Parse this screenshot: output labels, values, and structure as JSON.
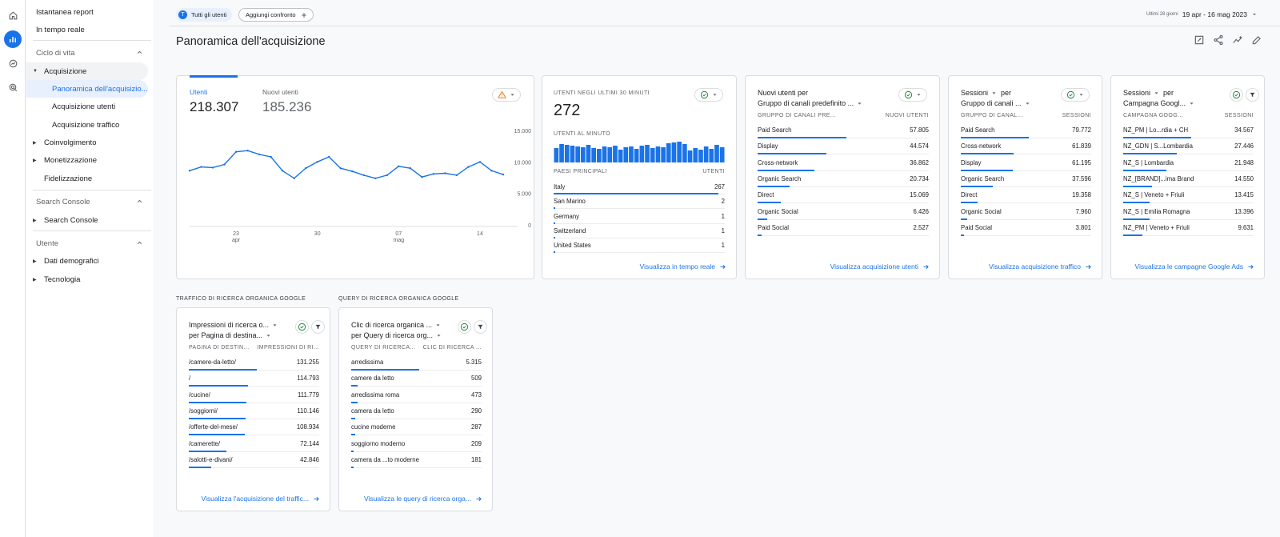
{
  "nav": {
    "top": [
      "Istantanea report",
      "In tempo reale"
    ],
    "section1": "Ciclo di vita",
    "acquisizione": "Acquisizione",
    "sub": [
      "Panoramica dell'acquisizio...",
      "Acquisizione utenti",
      "Acquisizione traffico"
    ],
    "coinvolgimento": "Coinvolgimento",
    "monetizzazione": "Monetizzazione",
    "fidelizzazione": "Fidelizzazione",
    "section2": "Search Console",
    "searchconsole": "Search Console",
    "section3": "Utente",
    "demografici": "Dati demografici",
    "tecnologia": "Tecnologia"
  },
  "topbar": {
    "chip_avatar": "T",
    "chip_label": "Tutti gli utenti",
    "compare_label": "Aggiungi confronto",
    "date_small": "Ultimi 28 giorni",
    "date_range": "19 apr - 16 mag 2023"
  },
  "page_title": "Panoramica dell'acquisizione",
  "overview": {
    "tab1_label": "Utenti",
    "tab1_value": "218.307",
    "tab2_label": "Nuovi utenti",
    "tab2_value": "185.236",
    "y_ticks": [
      "15.000",
      "10.000",
      "5.000",
      "0"
    ],
    "x_ticks": [
      {
        "day": "23",
        "month": "apr"
      },
      {
        "day": "30",
        "month": ""
      },
      {
        "day": "07",
        "month": "mag"
      },
      {
        "day": "14",
        "month": ""
      }
    ]
  },
  "chart_data": {
    "type": "line",
    "series": [
      {
        "values": [
          8600,
          9200,
          9100,
          9600,
          11600,
          11800,
          11200,
          10800,
          8600,
          7400,
          9000,
          10000,
          10800,
          9000,
          8500,
          7900,
          7400,
          7900,
          9300,
          9000,
          7600,
          8100,
          8200,
          7900,
          9200,
          10000,
          8600,
          8000
        ]
      }
    ],
    "ylim": [
      0,
      15000
    ],
    "x_tick_labels": [
      "23 apr",
      "30",
      "07 mag",
      "14"
    ],
    "grid": false
  },
  "realtime": {
    "caption": "UTENTI NEGLI ULTIMI 30 MINUTI",
    "value": "272",
    "per_min_caption": "UTENTI AL MINUTO",
    "per_min_values": [
      18,
      23,
      22,
      21,
      20,
      19,
      22,
      18,
      17,
      20,
      19,
      21,
      16,
      19,
      20,
      17,
      21,
      22,
      18,
      20,
      19,
      24,
      25,
      26,
      23,
      15,
      18,
      16,
      20,
      17,
      22,
      19
    ],
    "countries_header": "PAESI PRINCIPALI",
    "users_header": "UTENTI",
    "countries": [
      {
        "name": "Italy",
        "value": "267"
      },
      {
        "name": "San Marino",
        "value": "2"
      },
      {
        "name": "Germany",
        "value": "1"
      },
      {
        "name": "Switzerland",
        "value": "1"
      },
      {
        "name": "United States",
        "value": "1"
      }
    ],
    "link": "Visualizza in tempo reale"
  },
  "card_new_users": {
    "title1": "Nuovi utenti per",
    "title2": "Gruppo di canali predefinito ...",
    "col1": "GRUPPO DI CANALI PRE...",
    "col2": "NUOVI UTENTI",
    "rows": [
      {
        "label": "Paid Search",
        "value": "57.805"
      },
      {
        "label": "Display",
        "value": "44.574"
      },
      {
        "label": "Cross-network",
        "value": "36.862"
      },
      {
        "label": "Organic Search",
        "value": "20.734"
      },
      {
        "label": "Direct",
        "value": "15.069"
      },
      {
        "label": "Organic Social",
        "value": "6.426"
      },
      {
        "label": "Paid Social",
        "value": "2.527"
      }
    ],
    "link": "Visualizza acquisizione utenti"
  },
  "card_sessions": {
    "title1": "Sessioni",
    "title1b": "per",
    "title2": "Gruppo di canali ...",
    "col1": "GRUPPO DI CANAL...",
    "col2": "SESSIONI",
    "rows": [
      {
        "label": "Paid Search",
        "value": "79.772"
      },
      {
        "label": "Cross-network",
        "value": "61.839"
      },
      {
        "label": "Display",
        "value": "61.195"
      },
      {
        "label": "Organic Search",
        "value": "37.596"
      },
      {
        "label": "Direct",
        "value": "19.358"
      },
      {
        "label": "Organic Social",
        "value": "7.960"
      },
      {
        "label": "Paid Social",
        "value": "3.801"
      }
    ],
    "link": "Visualizza acquisizione traffico"
  },
  "card_campaign": {
    "title1": "Sessioni",
    "title1b": "per",
    "title2": "Campagna Googl...",
    "col1": "CAMPAGNA GOOG...",
    "col2": "SESSIONI",
    "rows": [
      {
        "label": "NZ_PM | Lo...rdia + CH",
        "value": "34.567"
      },
      {
        "label": "NZ_GDN | S...Lombardia",
        "value": "27.446"
      },
      {
        "label": "NZ_S | Lombardia",
        "value": "21.948"
      },
      {
        "label": "NZ_[BRAND]...ima Brand",
        "value": "14.550"
      },
      {
        "label": "NZ_S | Veneto + Friuli",
        "value": "13.415"
      },
      {
        "label": "NZ_S | Emilia Romagna",
        "value": "13.396"
      },
      {
        "label": "NZ_PM | Veneto + Friuli",
        "value": "9.631"
      }
    ],
    "link": "Visualizza le campagne Google Ads"
  },
  "organic_traffic": {
    "section": "TRAFFICO DI RICERCA ORGANICA GOOGLE",
    "title1": "Impressioni di ricerca o...",
    "title2": "per Pagina di destina...",
    "col1": "PAGINA DI DESTIN...",
    "col2": "IMPRESSIONI DI RI...",
    "rows": [
      {
        "label": "/camere-da-letto/",
        "value": "131.255"
      },
      {
        "label": "/",
        "value": "114.793"
      },
      {
        "label": "/cucine/",
        "value": "111.779"
      },
      {
        "label": "/soggiorni/",
        "value": "110.146"
      },
      {
        "label": "/offerte-del-mese/",
        "value": "108.934"
      },
      {
        "label": "/camerette/",
        "value": "72.144"
      },
      {
        "label": "/salotti-e-divani/",
        "value": "42.846"
      }
    ],
    "link": "Visualizza l'acquisizione del traffic..."
  },
  "organic_query": {
    "section": "QUERY DI RICERCA ORGANICA GOOGLE",
    "title1": "Clic di ricerca organica ...",
    "title2": "per Query di ricerca org...",
    "col1": "QUERY DI RICERCA...",
    "col2": "CLIC DI RICERCA ...",
    "rows": [
      {
        "label": "arredissima",
        "value": "5.315"
      },
      {
        "label": "camere da letto",
        "value": "509"
      },
      {
        "label": "arredissima roma",
        "value": "473"
      },
      {
        "label": "camera da letto",
        "value": "290"
      },
      {
        "label": "cucine moderne",
        "value": "287"
      },
      {
        "label": "soggiorno moderno",
        "value": "209"
      },
      {
        "label": "camera da ...to moderne",
        "value": "181"
      }
    ],
    "link": "Visualizza le query di ricerca orga..."
  },
  "colors": {
    "accent": "#1a73e8",
    "warning": "#e37400",
    "ok": "#188038"
  }
}
